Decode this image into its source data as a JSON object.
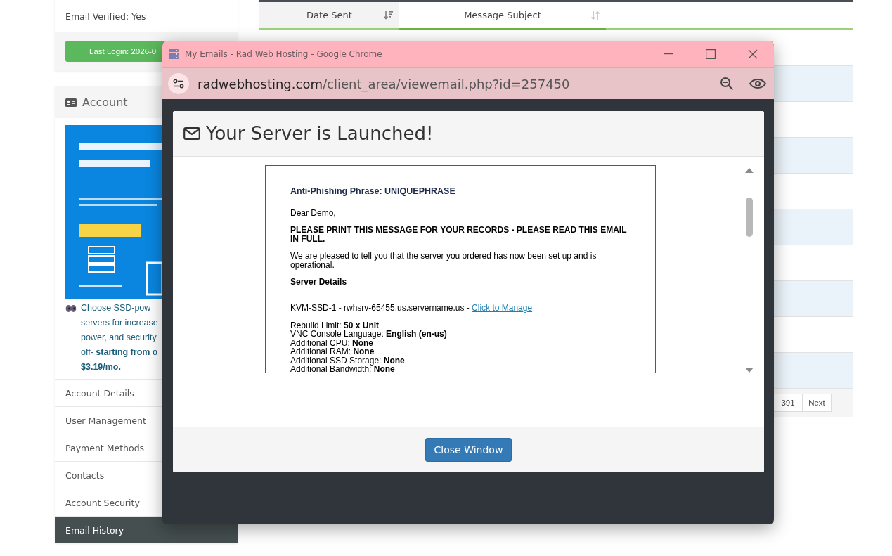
{
  "profile": {
    "email_verified": "Email Verified: Yes",
    "last_login": "Last Login: 2026-0"
  },
  "account": {
    "title": "Account",
    "banner": {
      "kind": "picture"
    },
    "promo_lines": [
      "Choose SSD-pow",
      "servers for increase",
      "power, and security",
      "off- **starting from o**",
      "**$3.19/mo.**"
    ],
    "items": [
      {
        "label": "Account Details",
        "selected": false
      },
      {
        "label": "User Management",
        "selected": false
      },
      {
        "label": "Payment Methods",
        "selected": false
      },
      {
        "label": "Contacts",
        "selected": false
      },
      {
        "label": "Account Security",
        "selected": false
      },
      {
        "label": "Email History",
        "selected": true
      }
    ]
  },
  "table": {
    "columns": [
      {
        "label": "Date Sent",
        "sorted": true
      },
      {
        "label": "Message Subject",
        "sorted": false
      }
    ],
    "rows": [
      {
        "striped": false
      },
      {
        "striped": true
      },
      {
        "striped": false
      },
      {
        "striped": true
      },
      {
        "striped": false
      },
      {
        "striped": true
      },
      {
        "striped": false
      },
      {
        "striped": true
      },
      {
        "striped": false
      },
      {
        "striped": true
      }
    ],
    "pagination": [
      "391",
      "Next"
    ]
  },
  "popup": {
    "title": "My Emails - Rad Web Hosting - Google Chrome",
    "url_host": "radwebhosting.com",
    "url_path": "/client_area/viewemail.php?id=257450",
    "heading": "Your Server is Launched!",
    "email": {
      "anti_phishing": "Anti-Phishing Phrase: UNIQUEPHRASE",
      "greeting": "Dear Demo,",
      "notice": "PLEASE PRINT THIS MESSAGE FOR YOUR RECORDS - PLEASE READ THIS EMAIL IN FULL.",
      "intro": "We are pleased to tell you that the server you ordered has now been set up and is operational.",
      "section_title": "Server Details",
      "separator": "============================",
      "server_line": "KVM-SSD-1 - rwhsrv-65455.us.servername.us - ",
      "manage_link": "Click to Manage",
      "details": [
        {
          "label": "Rebuild Limit: ",
          "value": "50 x Unit"
        },
        {
          "label": "VNC Console Language: ",
          "value": "English (en-us)"
        },
        {
          "label": "Additional CPU: ",
          "value": "None"
        },
        {
          "label": "Additional RAM: ",
          "value": "None"
        },
        {
          "label": "Additional SSD Storage: ",
          "value": "None"
        },
        {
          "label": "Additional Bandwidth: ",
          "value": "None"
        }
      ]
    },
    "close_button": "Close Window"
  }
}
